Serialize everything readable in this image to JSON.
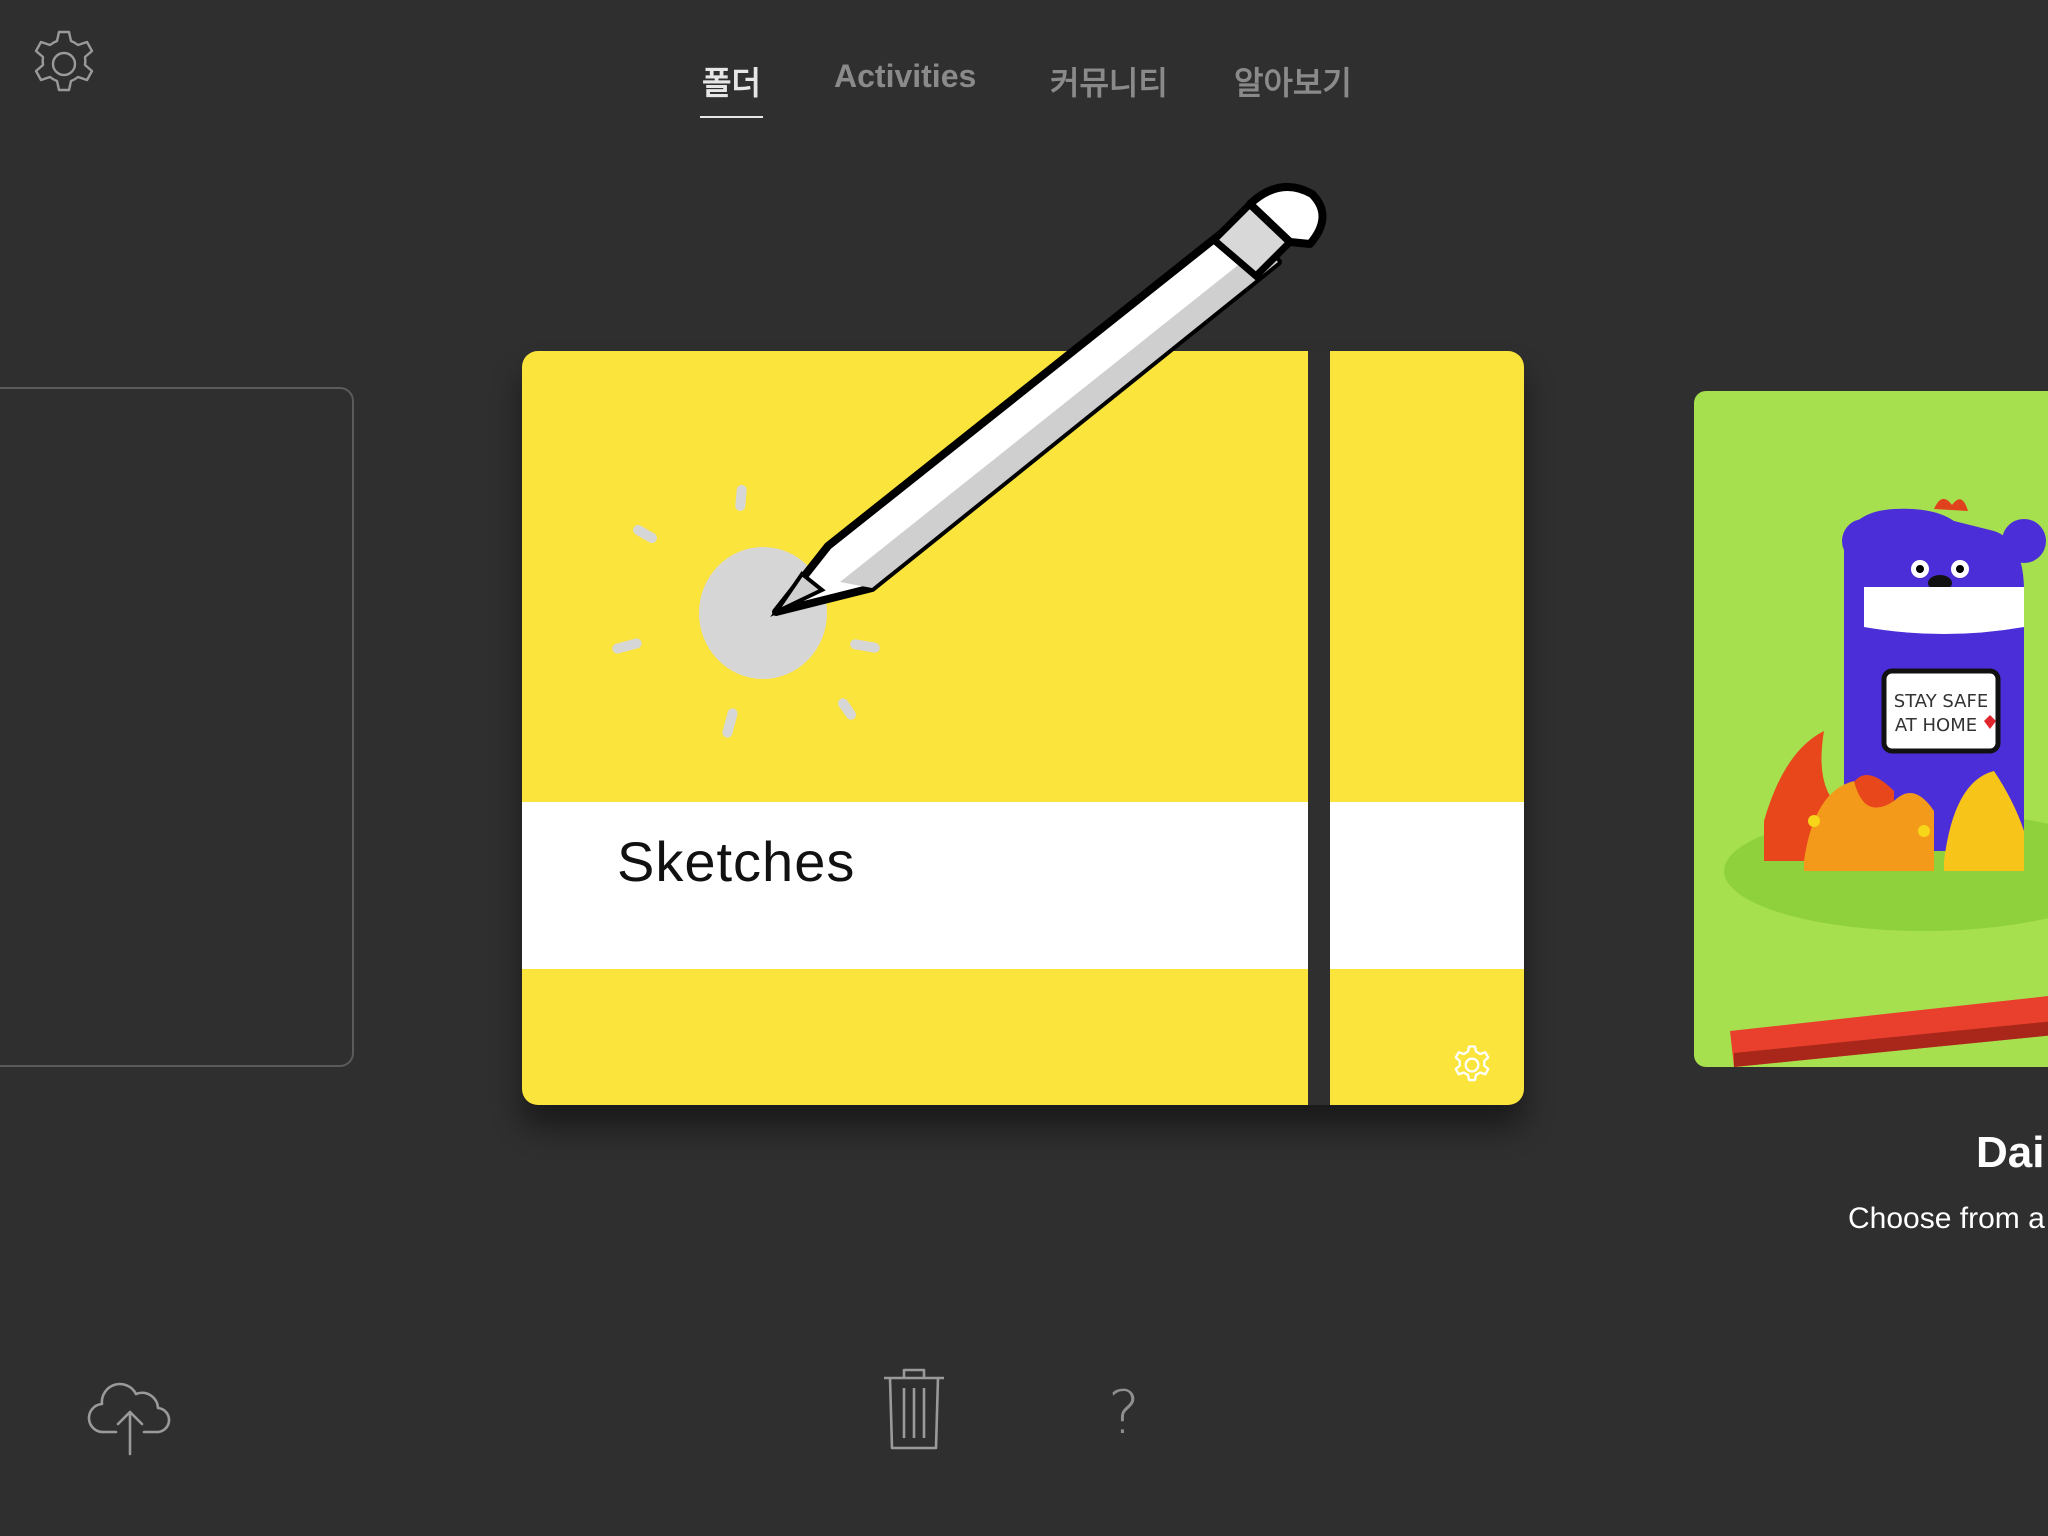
{
  "header": {
    "tabs": [
      {
        "label": "폴더",
        "active": true
      },
      {
        "label": "Activities",
        "active": false
      },
      {
        "label": "커뮤니티",
        "active": false
      },
      {
        "label": "알아보기",
        "active": false
      }
    ]
  },
  "carousel": {
    "sketchbook": {
      "title": "Sketches",
      "cover_color": "#fbe43b"
    },
    "daily_card": {
      "title": "Dai",
      "subtitle": "Choose from a",
      "sign_text_line1": "STAY SAFE",
      "sign_text_line2": "AT HOME"
    }
  },
  "icons": {
    "settings": "gear-icon",
    "upload": "cloud-upload-icon",
    "trash": "trash-icon",
    "help": "question-mark-icon"
  },
  "toolbar": {
    "help_label": "?"
  }
}
